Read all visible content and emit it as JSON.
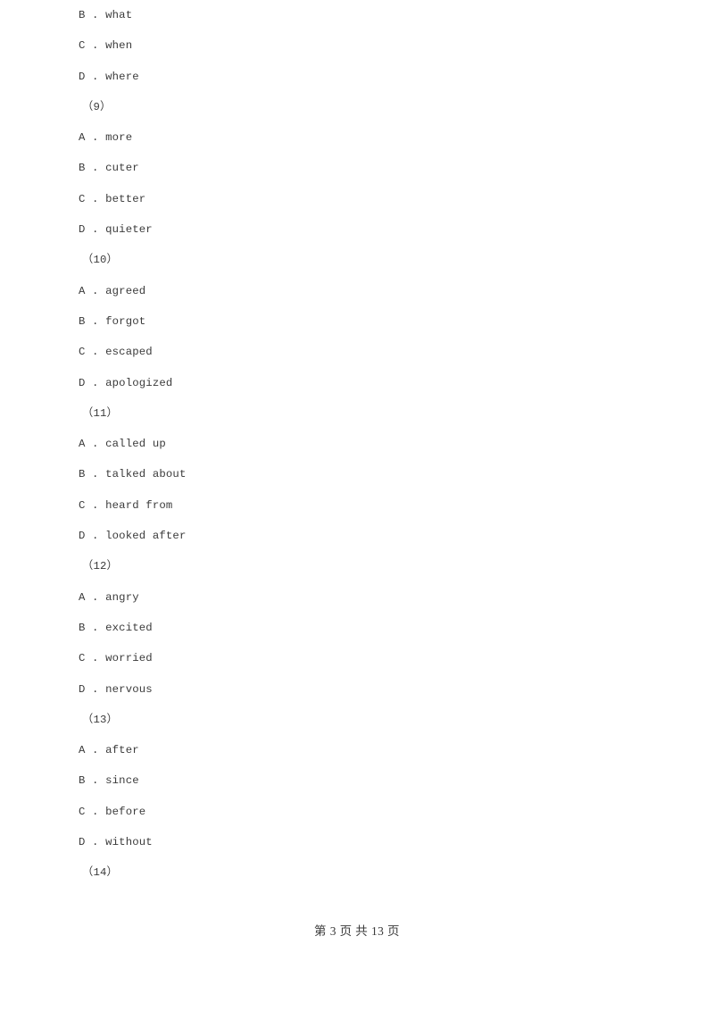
{
  "document": {
    "background_color": "#ffffff",
    "text_color": "#3b3b3b",
    "lines": [
      {
        "kind": "option",
        "text": "B . what"
      },
      {
        "kind": "option",
        "text": "C . when"
      },
      {
        "kind": "option",
        "text": "D . where"
      },
      {
        "kind": "qnum",
        "text": "（9）"
      },
      {
        "kind": "option",
        "text": "A . more"
      },
      {
        "kind": "option",
        "text": "B . cuter"
      },
      {
        "kind": "option",
        "text": "C . better"
      },
      {
        "kind": "option",
        "text": "D . quieter"
      },
      {
        "kind": "qnum",
        "text": "（10）"
      },
      {
        "kind": "option",
        "text": "A . agreed"
      },
      {
        "kind": "option",
        "text": "B . forgot"
      },
      {
        "kind": "option",
        "text": "C . escaped"
      },
      {
        "kind": "option",
        "text": "D . apologized"
      },
      {
        "kind": "qnum",
        "text": "（11）"
      },
      {
        "kind": "option",
        "text": "A . called up"
      },
      {
        "kind": "option",
        "text": "B . talked about"
      },
      {
        "kind": "option",
        "text": "C . heard from"
      },
      {
        "kind": "option",
        "text": "D . looked after"
      },
      {
        "kind": "qnum",
        "text": "（12）"
      },
      {
        "kind": "option",
        "text": "A . angry"
      },
      {
        "kind": "option",
        "text": "B . excited"
      },
      {
        "kind": "option",
        "text": "C . worried"
      },
      {
        "kind": "option",
        "text": "D . nervous"
      },
      {
        "kind": "qnum",
        "text": "（13）"
      },
      {
        "kind": "option",
        "text": "A . after"
      },
      {
        "kind": "option",
        "text": "B . since"
      },
      {
        "kind": "option",
        "text": "C . before"
      },
      {
        "kind": "option",
        "text": "D . without"
      },
      {
        "kind": "qnum",
        "text": "（14）"
      }
    ]
  },
  "footer": {
    "text": "第 3 页 共 13 页",
    "current_page": "3",
    "total_pages": "13"
  }
}
